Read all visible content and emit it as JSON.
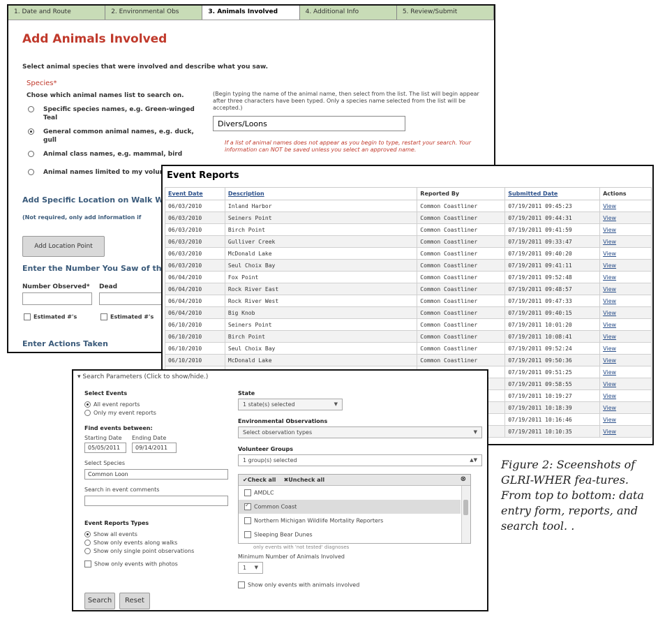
{
  "form": {
    "steps": [
      "1. Date and Route",
      "2. Environmental Obs",
      "3. Animals Involved",
      "4. Additional Info",
      "5. Review/Submit"
    ],
    "title": "Add Animals Involved",
    "intro": "Select animal species that were involved and describe what you saw.",
    "species_label": "Species*",
    "choose_label": "Chose which animal names list to search on.",
    "options": [
      {
        "label": "Specific species names, e.g. Green-winged Teal",
        "selected": false
      },
      {
        "label": "General common animal names, e.g. duck, gull",
        "selected": true
      },
      {
        "label": "Animal class names, e.g. mammal, bird",
        "selected": false
      },
      {
        "label": "Animal names limited to my volunt",
        "selected": false
      }
    ],
    "help_text": "(Begin typing the name of the animal name, then select from the list. The list will begin appear after three characters have been typed. Only a species name selected from the list will be accepted.)",
    "species_value": "Divers/Loons",
    "warning": "If a list of animal names does not appear as you begin to type, restart your search. Your information can NOT be saved unless you select an approved name.",
    "location_heading": "Add Specific Location on Walk Wh",
    "location_note": "(Not required, only add information if",
    "add_location_button": "Add Location Point",
    "number_heading": "Enter the Number You Saw of this",
    "number_observed_label": "Number Observed*",
    "dead_label": "Dead",
    "estimated_label_1": "Estimated #'s",
    "estimated_label_2": "Estimated #'s",
    "actions_heading": "Enter Actions Taken"
  },
  "reports": {
    "title": "Event Reports",
    "columns": [
      "Event Date",
      "Description",
      "Reported By",
      "Submitted Date",
      "Actions"
    ],
    "rows": [
      [
        "06/03/2010",
        "Inland Harbor",
        "Common Coastliner",
        "07/19/2011 09:45:23",
        "View"
      ],
      [
        "06/03/2010",
        "Seiners Point",
        "Common Coastliner",
        "07/19/2011 09:44:31",
        "View"
      ],
      [
        "06/03/2010",
        "Birch Point",
        "Common Coastliner",
        "07/19/2011 09:41:59",
        "View"
      ],
      [
        "06/03/2010",
        "Gulliver Creek",
        "Common Coastliner",
        "07/19/2011 09:33:47",
        "View"
      ],
      [
        "06/03/2010",
        "McDonald Lake",
        "Common Coastliner",
        "07/19/2011 09:40:20",
        "View"
      ],
      [
        "06/03/2010",
        "Seul Choix Bay",
        "Common Coastliner",
        "07/19/2011 09:41:11",
        "View"
      ],
      [
        "06/04/2010",
        "Fox Point",
        "Common Coastliner",
        "07/19/2011 09:52:48",
        "View"
      ],
      [
        "06/04/2010",
        "Rock River East",
        "Common Coastliner",
        "07/19/2011 09:48:57",
        "View"
      ],
      [
        "06/04/2010",
        "Rock River West",
        "Common Coastliner",
        "07/19/2011 09:47:33",
        "View"
      ],
      [
        "06/04/2010",
        "Big Knob",
        "Common Coastliner",
        "07/19/2011 09:40:15",
        "View"
      ],
      [
        "06/10/2010",
        "Seiners Point",
        "Common Coastliner",
        "07/19/2011 10:01:20",
        "View"
      ],
      [
        "06/10/2010",
        "Birch Point",
        "Common Coastliner",
        "07/19/2011 10:08:41",
        "View"
      ],
      [
        "06/10/2010",
        "Seul Choix Bay",
        "Common Coastliner",
        "07/19/2011 09:52:24",
        "View"
      ],
      [
        "06/10/2010",
        "McDonald Lake",
        "Common Coastliner",
        "07/19/2011 09:50:36",
        "View"
      ],
      [
        "",
        "",
        "",
        "07/19/2011 09:51:25",
        "View"
      ],
      [
        "",
        "",
        "",
        "07/19/2011 09:58:55",
        "View"
      ],
      [
        "",
        "",
        "",
        "07/19/2011 10:19:27",
        "View"
      ],
      [
        "",
        "",
        "",
        "07/19/2011 10:18:39",
        "View"
      ],
      [
        "",
        "",
        "",
        "07/19/2011 10:16:46",
        "View"
      ],
      [
        "",
        "",
        "",
        "07/19/2011 10:10:35",
        "View"
      ]
    ]
  },
  "search": {
    "header": "▾ Search Parameters (Click to show/hide.)",
    "select_events_label": "Select Events",
    "all_reports": "All event reports",
    "my_reports": "Only my event reports",
    "find_between_label": "Find events between:",
    "start_label": "Starting Date",
    "end_label": "Ending Date",
    "start_value": "05/05/2011",
    "end_value": "09/14/2011",
    "select_species_label": "Select Species",
    "species_value": "Common Loon",
    "comments_label": "Search in event comments",
    "types_label": "Event Reports Types",
    "type_options": [
      "Show all events",
      "Show only events along walks",
      "Show only single point observations"
    ],
    "photos_label": "Show only events with photos",
    "state_label": "State",
    "state_value": "1 state(s) selected",
    "env_label": "Environmental Observations",
    "env_value": "Select observation types",
    "groups_label": "Volunteer Groups",
    "groups_value": "1 group(s) selected",
    "check_all": "✔Check all",
    "uncheck_all": "✖Uncheck all",
    "group_items": [
      {
        "label": "AMDLC",
        "checked": false
      },
      {
        "label": "Common Coast",
        "checked": true
      },
      {
        "label": "Northern Michigan Wildlife Mortality Reporters",
        "checked": false
      },
      {
        "label": "Sleeping Bear Dunes",
        "checked": false
      }
    ],
    "hidden_peek": "only events with 'not tested' diagnoses",
    "min_animals_label": "Minimum Number of Animals Involved",
    "min_animals_value": "1",
    "animals_only_label": "Show only events with animals involved",
    "search_button": "Search",
    "reset_button": "Reset"
  },
  "caption": "Figure 2: Sceenshots of GLRI-WHER fea-tures. From top to bottom: data entry form, reports, and search tool. ."
}
